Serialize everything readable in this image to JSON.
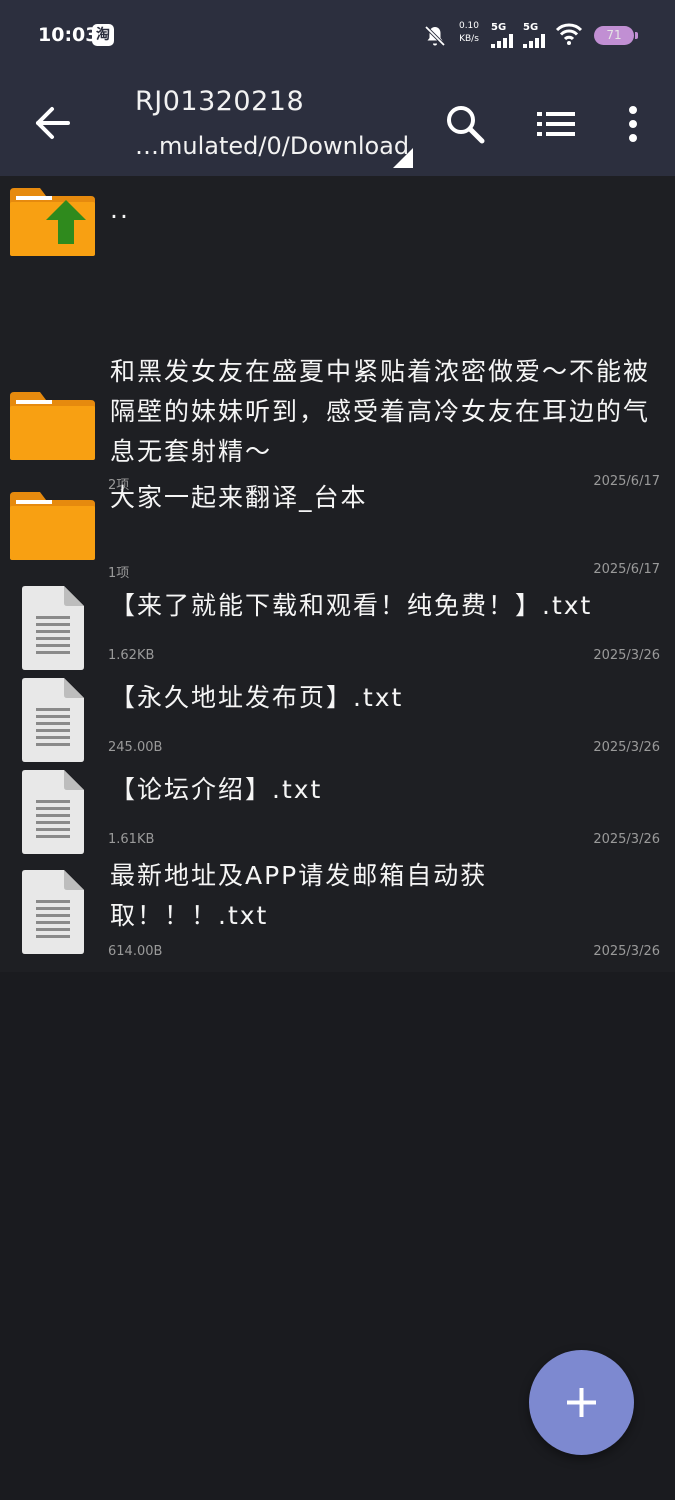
{
  "status_bar": {
    "time": "10:03",
    "app_icon": "淘",
    "speed_value": "0.10",
    "speed_unit": "KB/s",
    "sim1_label": "5G",
    "sim2_label": "5G",
    "battery": "71",
    "icons": [
      "taobao-icon",
      "mute-bell-icon",
      "signal-icon",
      "wifi-icon",
      "battery-icon"
    ]
  },
  "toolbar": {
    "title": "RJ01320218",
    "path": "…mulated/0/Download",
    "icons": [
      "back-arrow-icon",
      "search-icon",
      "list-view-icon",
      "more-vert-icon"
    ]
  },
  "files": [
    {
      "type": "parent",
      "name": "..",
      "meta": "",
      "date": ""
    },
    {
      "type": "folder",
      "name": "和黑发女友在盛夏中紧贴着浓密做爱～不能被隔壁的妹妹听到，感受着高冷女友在耳边的气息无套射精～",
      "meta": "2项",
      "date": "2025/6/17"
    },
    {
      "type": "folder",
      "name": "大家一起来翻译_台本",
      "meta": "1项",
      "date": "2025/6/17"
    },
    {
      "type": "file",
      "name": "【来了就能下载和观看！纯免费！】.txt",
      "meta": "1.62KB",
      "date": "2025/3/26"
    },
    {
      "type": "file",
      "name": "【永久地址发布页】.txt",
      "meta": "245.00B",
      "date": "2025/3/26"
    },
    {
      "type": "file",
      "name": "【论坛介绍】.txt",
      "meta": "1.61KB",
      "date": "2025/3/26"
    },
    {
      "type": "file",
      "name": "最新地址及APP请发邮箱自动获取！！！.txt",
      "meta": "614.00B",
      "date": "2025/3/26"
    }
  ],
  "fab": {
    "icon": "plus-icon"
  },
  "colors": {
    "toolbar_bg": "#2c2f3e",
    "list_bg": "#1e1f23",
    "folder": "#f8a012",
    "fab": "#7d89d0"
  }
}
